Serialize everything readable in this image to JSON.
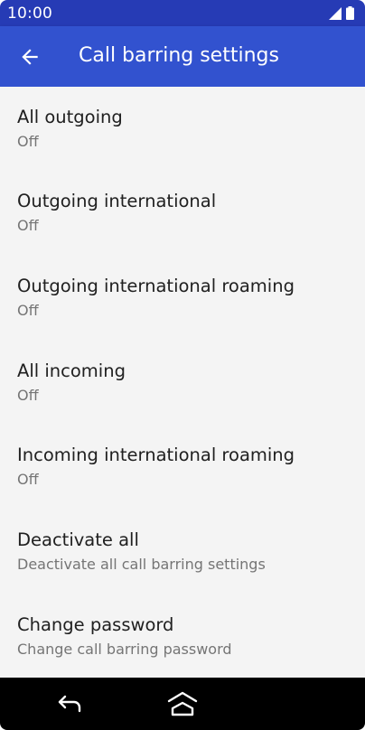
{
  "status_bar": {
    "time": "10:00",
    "icons": [
      "cellular-signal-icon",
      "battery-icon"
    ]
  },
  "app_bar": {
    "title": "Call barring settings",
    "back_icon": "arrow-back-icon"
  },
  "settings": [
    {
      "title": "All outgoing",
      "summary": "Off"
    },
    {
      "title": "Outgoing international",
      "summary": "Off"
    },
    {
      "title": "Outgoing international roaming",
      "summary": "Off"
    },
    {
      "title": "All incoming",
      "summary": "Off"
    },
    {
      "title": "Incoming international roaming",
      "summary": "Off"
    },
    {
      "title": "Deactivate all",
      "summary": "Deactivate all call barring settings"
    },
    {
      "title": "Change password",
      "summary": "Change call barring password"
    }
  ],
  "nav_bar": {
    "buttons": [
      "nav-back-icon",
      "nav-home-icon"
    ]
  },
  "colors": {
    "status_bar": "#263bb5",
    "app_bar": "#3252cf",
    "background": "#f4f4f4",
    "title_text": "#202020",
    "summary_text": "#757575",
    "nav_bar": "#000000"
  }
}
